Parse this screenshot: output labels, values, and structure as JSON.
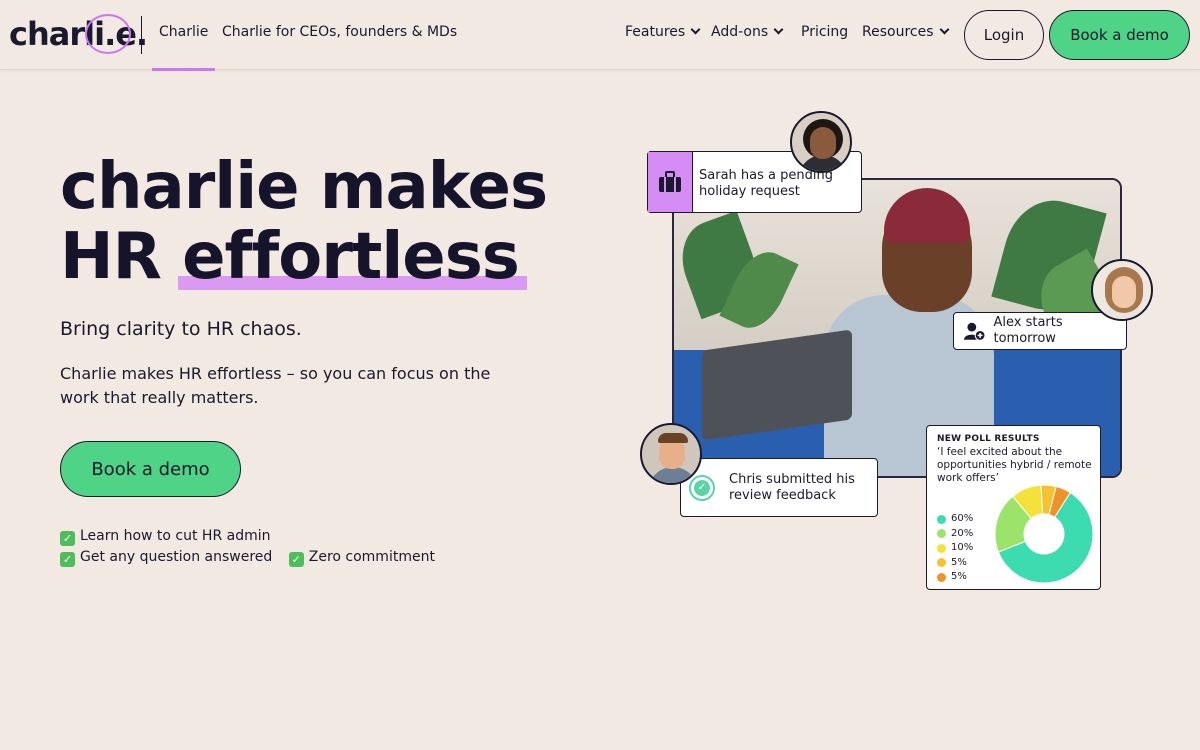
{
  "nav": {
    "logo_text": "charli.e.",
    "links": [
      {
        "label": "Charlie"
      },
      {
        "label": "Charlie for CEOs, founders & MDs"
      },
      {
        "label": "Features"
      },
      {
        "label": "Add-ons"
      },
      {
        "label": "Pricing"
      },
      {
        "label": "Resources"
      }
    ],
    "login_label": "Login",
    "demo_label": "Book a demo"
  },
  "hero": {
    "headline_line1": "charlie makes",
    "headline_line2_a": "HR",
    "headline_line2_b": "effortless",
    "subhead": "Bring clarity to HR chaos.",
    "body": "Charlie makes HR effortless – so you can focus on the work that really matters.",
    "cta_label": "Book a demo",
    "benefits": [
      "Learn how to cut HR admin",
      "Get any question answered",
      "Zero commitment"
    ]
  },
  "cards": {
    "sarah": "Sarah has a pending holiday request",
    "alex": "Alex starts tomorrow",
    "chris": "Chris submitted his review feedback"
  },
  "poll": {
    "title": "NEW POLL RESULTS",
    "question": "‘I feel excited about the opportunities hybrid / remote work offers’",
    "results": [
      {
        "label": "60%",
        "value": 60,
        "color": "#3ddbb0"
      },
      {
        "label": "20%",
        "value": 20,
        "color": "#9be36b"
      },
      {
        "label": "10%",
        "value": 10,
        "color": "#f4e23a"
      },
      {
        "label": "5%",
        "value": 5,
        "color": "#f5c232"
      },
      {
        "label": "5%",
        "value": 5,
        "color": "#f0922a"
      }
    ]
  },
  "colors": {
    "background": "#f3e9e3",
    "accent_green": "#4fd386",
    "accent_purple": "#d58cf4",
    "text": "#1a1a2e"
  }
}
